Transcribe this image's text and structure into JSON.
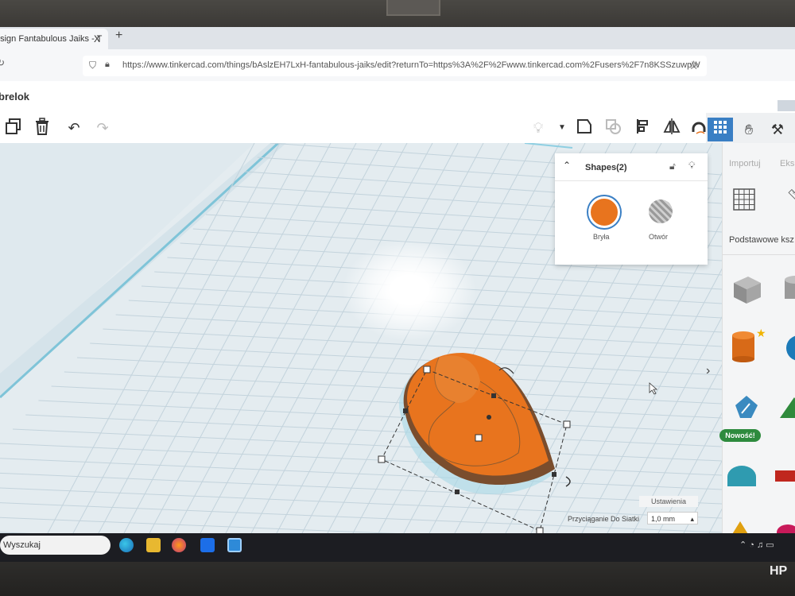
{
  "browser": {
    "tab_title": "esign Fantabulous Jaiks - T",
    "tab_close": "X",
    "new_tab": "+",
    "url": "https://www.tinkercad.com/things/bAslzEH7LxH-fantabulous-jaiks/edit?returnTo=https%3A%2F%2Fwww.tinkercad.com%2Fusers%2F7n8KSSzuwpW"
  },
  "app": {
    "project_name": "brelok"
  },
  "toolbar": {
    "buttons": [
      "copy-icon",
      "trash-icon",
      "undo-icon",
      "redo-icon"
    ],
    "right_buttons": [
      "lightbulb-icon",
      "group-icon",
      "ungroup-icon",
      "align-icon",
      "mirror-icon",
      "magnet-icon"
    ]
  },
  "view_buttons": [
    "grid-view-icon",
    "blocks-icon",
    "bricks-icon"
  ],
  "right_panel": {
    "import_label": "Importuj",
    "export_label": "Eksp",
    "category_title": "Podstawowe ksz",
    "new_badge": "Nowość!"
  },
  "shapes_panel": {
    "title": "Shapes(2)",
    "solid_label": "Bryła",
    "hole_label": "Otwór",
    "solid_color": "#e8741e"
  },
  "workplane": {
    "settings_label": "Ustawienia",
    "snap_label": "Przyciąganie Do Siatki",
    "snap_value": "1,0 mm"
  },
  "taskbar": {
    "search_label": "Wyszukaj",
    "apps": [
      "edge-icon",
      "explorer-icon",
      "firefox-icon",
      "dropbox-icon",
      "app-c-icon"
    ]
  },
  "bezel": {
    "brand": "HP"
  }
}
